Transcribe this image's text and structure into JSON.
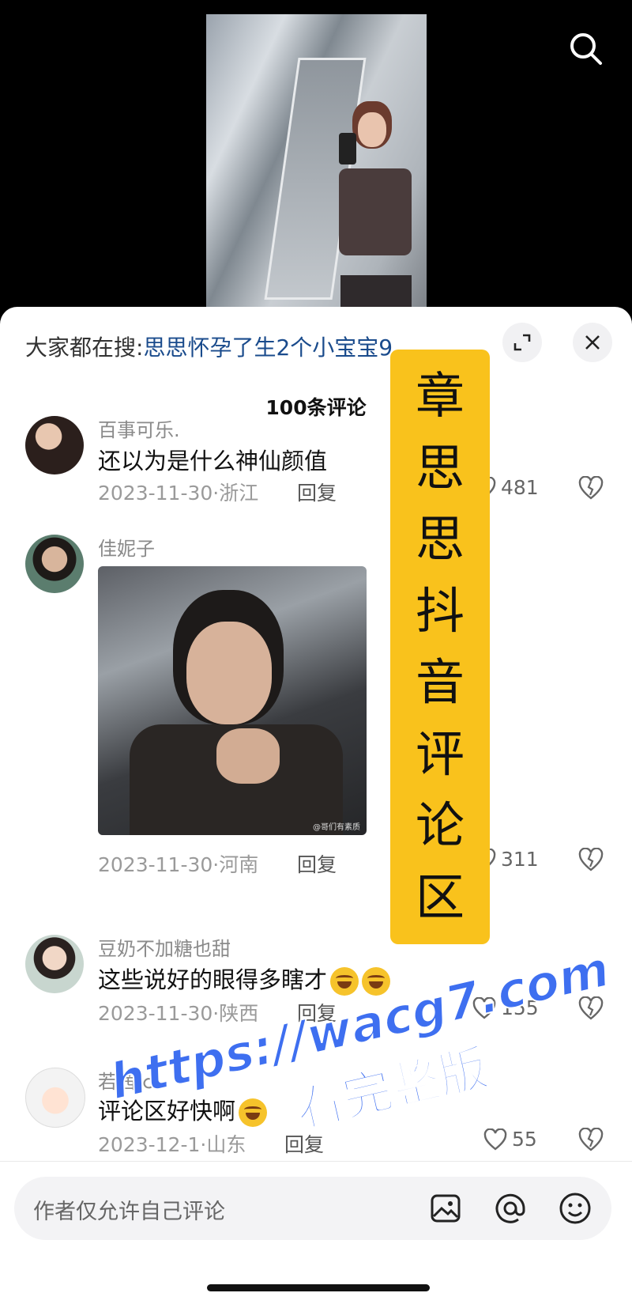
{
  "video": {
    "icon": "video-frame"
  },
  "search": {
    "icon": "search-icon"
  },
  "sheet": {
    "trend_prefix": "大家都在搜:",
    "trend_link": "思思怀孕了生2个小宝宝9",
    "comment_count": "100条评论"
  },
  "comments": [
    {
      "user": "百事可乐.",
      "text": "还以为是什么神仙颜值",
      "meta": "2023-11-30·浙江",
      "reply": "回复",
      "likes": "481"
    },
    {
      "user": "佳妮子",
      "text": "",
      "meta": "2023-11-30·河南",
      "reply": "回复",
      "likes": "311",
      "image_watermark": "@哥们有素质"
    },
    {
      "user": "豆奶不加糖也甜",
      "text": "这些说好的眼得多瞎才",
      "meta": "2023-11-30·陕西",
      "reply": "回复",
      "likes": "155"
    },
    {
      "user": "若茜·♂",
      "text": "评论区好快啊",
      "meta": "2023-12-1·山东",
      "reply": "回复",
      "likes": "55"
    }
  ],
  "input": {
    "placeholder": "作者仅允许自己评论"
  },
  "overlay": {
    "banner": [
      "章",
      "思",
      "思",
      "抖",
      "音",
      "评",
      "论",
      "区"
    ],
    "watermark_url": "https://wacg7.com",
    "watermark_sub": "看完整版"
  },
  "colors": {
    "banner": "#f9c21c",
    "watermark": "#3e6ff0",
    "trend_link": "#1a4b8c"
  }
}
